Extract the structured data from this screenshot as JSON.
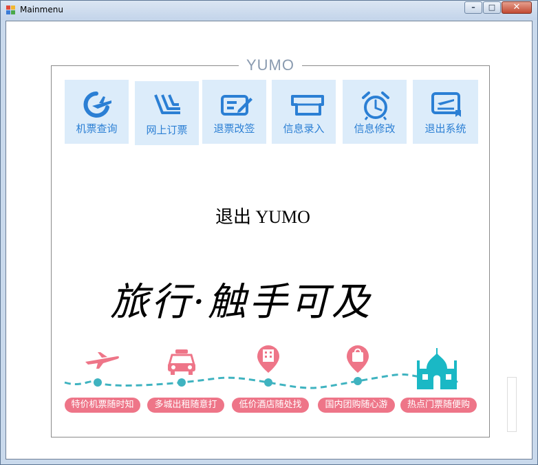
{
  "window": {
    "title": "Mainmenu",
    "min_glyph": "–",
    "max_glyph": "□",
    "close_glyph": "✕"
  },
  "group": {
    "title": "YUMO"
  },
  "menu": [
    {
      "label": "机票查询",
      "icon": "plane-takeoff-icon"
    },
    {
      "label": "网上订票",
      "icon": "seat-icon"
    },
    {
      "label": "退票改签",
      "icon": "ticket-edit-icon"
    },
    {
      "label": "信息录入",
      "icon": "ticket-stub-icon"
    },
    {
      "label": "信息修改",
      "icon": "alarm-clock-icon"
    },
    {
      "label": "退出系统",
      "icon": "boarding-pass-icon"
    }
  ],
  "center": {
    "exit_text": "退出 YUMO",
    "slogan": "旅行·触手可及"
  },
  "banner": [
    {
      "label": "特价机票随时知",
      "icon": "plane-icon"
    },
    {
      "label": "多城出租随意打",
      "icon": "car-icon"
    },
    {
      "label": "低价酒店随处找",
      "icon": "hotel-pin-icon"
    },
    {
      "label": "国内团购随心游",
      "icon": "shopping-bag-pin-icon"
    },
    {
      "label": "热点门票随便购",
      "icon": "taj-mahal-icon"
    }
  ],
  "colors": {
    "accent_blue": "#2b7fd4",
    "tile_bg": "#dcecfa",
    "pink": "#ee7588",
    "teal": "#3fb3c0"
  }
}
